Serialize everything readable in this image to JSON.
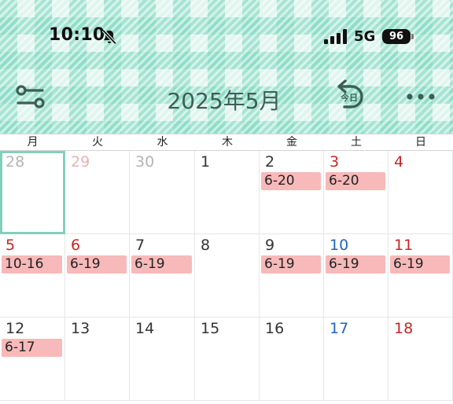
{
  "status_bar": {
    "time": "10:10",
    "network": "5G",
    "battery": "96",
    "icons": [
      "bell-slash-icon",
      "signal-icon"
    ]
  },
  "toolbar": {
    "title": "2025年5月",
    "filter_icon": "sliders-icon",
    "today_label": "今日",
    "today_icon": "undo-arrow-icon",
    "more_icon": "ellipsis-icon"
  },
  "colors": {
    "header_mint": "#82dac0",
    "title": "#3d5e55",
    "holiday_red": "#c82525",
    "saturday_blue": "#1f66b8",
    "event_pink": "#f7b9b9",
    "selected_border": "#84cfbc"
  },
  "weekdays": [
    "月",
    "火",
    "水",
    "木",
    "金",
    "土",
    "日"
  ],
  "weeks": [
    [
      {
        "day": "28",
        "style": "prev",
        "selected": true
      },
      {
        "day": "29",
        "style": "prev-sun"
      },
      {
        "day": "30",
        "style": "prev"
      },
      {
        "day": "1"
      },
      {
        "day": "2",
        "event": "6-20"
      },
      {
        "day": "3",
        "style": "red",
        "event": "6-20"
      },
      {
        "day": "4",
        "style": "red"
      }
    ],
    [
      {
        "day": "5",
        "style": "red",
        "event": "10-16"
      },
      {
        "day": "6",
        "style": "red",
        "event": "6-19"
      },
      {
        "day": "7",
        "event": "6-19"
      },
      {
        "day": "8"
      },
      {
        "day": "9",
        "event": "6-19"
      },
      {
        "day": "10",
        "style": "blue",
        "event": "6-19"
      },
      {
        "day": "11",
        "style": "red",
        "event": "6-19"
      }
    ],
    [
      {
        "day": "12",
        "event": "6-17"
      },
      {
        "day": "13"
      },
      {
        "day": "14"
      },
      {
        "day": "15"
      },
      {
        "day": "16"
      },
      {
        "day": "17",
        "style": "blue"
      },
      {
        "day": "18",
        "style": "red"
      }
    ]
  ]
}
